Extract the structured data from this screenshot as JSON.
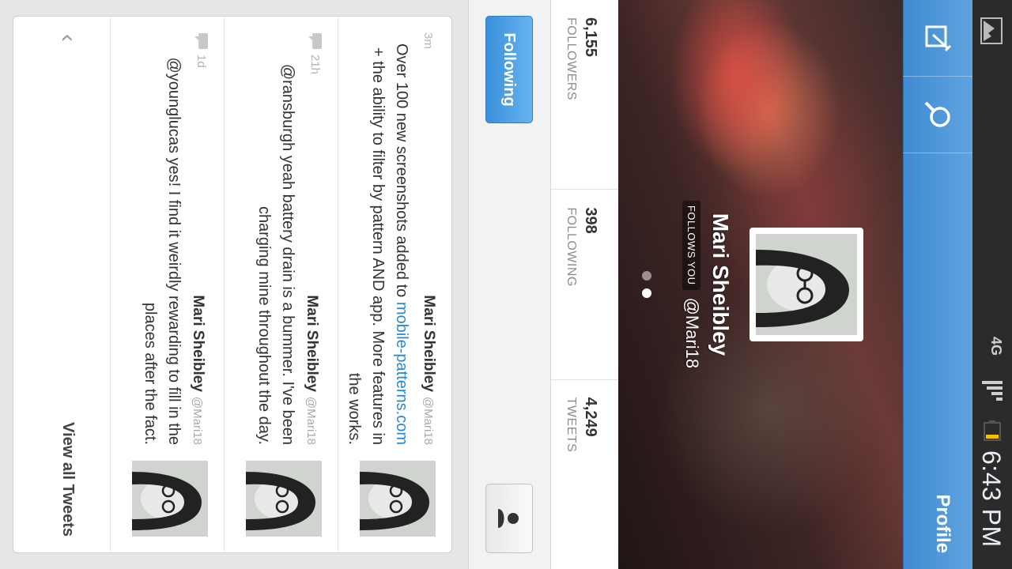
{
  "status_bar": {
    "network": "4G",
    "time": "6:43 PM"
  },
  "action_bar": {
    "title": "Profile",
    "icons": [
      "compose-icon",
      "search-icon"
    ]
  },
  "profile": {
    "name": "Mari Sheibley",
    "handle": "@Mari18",
    "follows_you": "FOLLOWS YOU",
    "stats": [
      {
        "num": "6,155",
        "label": "FOLLOWERS"
      },
      {
        "num": "398",
        "label": "FOLLOWING"
      },
      {
        "num": "4,249",
        "label": "TWEETS"
      }
    ],
    "follow_button": "Following"
  },
  "tweets": [
    {
      "author": "Mari Sheibley",
      "username": "@Mari18",
      "age": "3m",
      "text_before": "Over 100 new screenshots added to ",
      "link": "mobile-patterns.com",
      "text_after": " + the ability to filter by pattern AND app. More features in the works."
    },
    {
      "author": "Mari Sheibley",
      "username": "@Mari18",
      "age": "21h",
      "text": "@ransburgh yeah battery drain is a bummer. I've been charging mine throughout the day."
    },
    {
      "author": "Mari Sheibley",
      "username": "@Mari18",
      "age": "1d",
      "text": "@younglucas yes! I find it weirdly rewarding to fill in the places after the fact."
    }
  ],
  "view_all": "View all Tweets",
  "colors": {
    "accent": "#3f8bd1",
    "link": "#2a87d0"
  }
}
